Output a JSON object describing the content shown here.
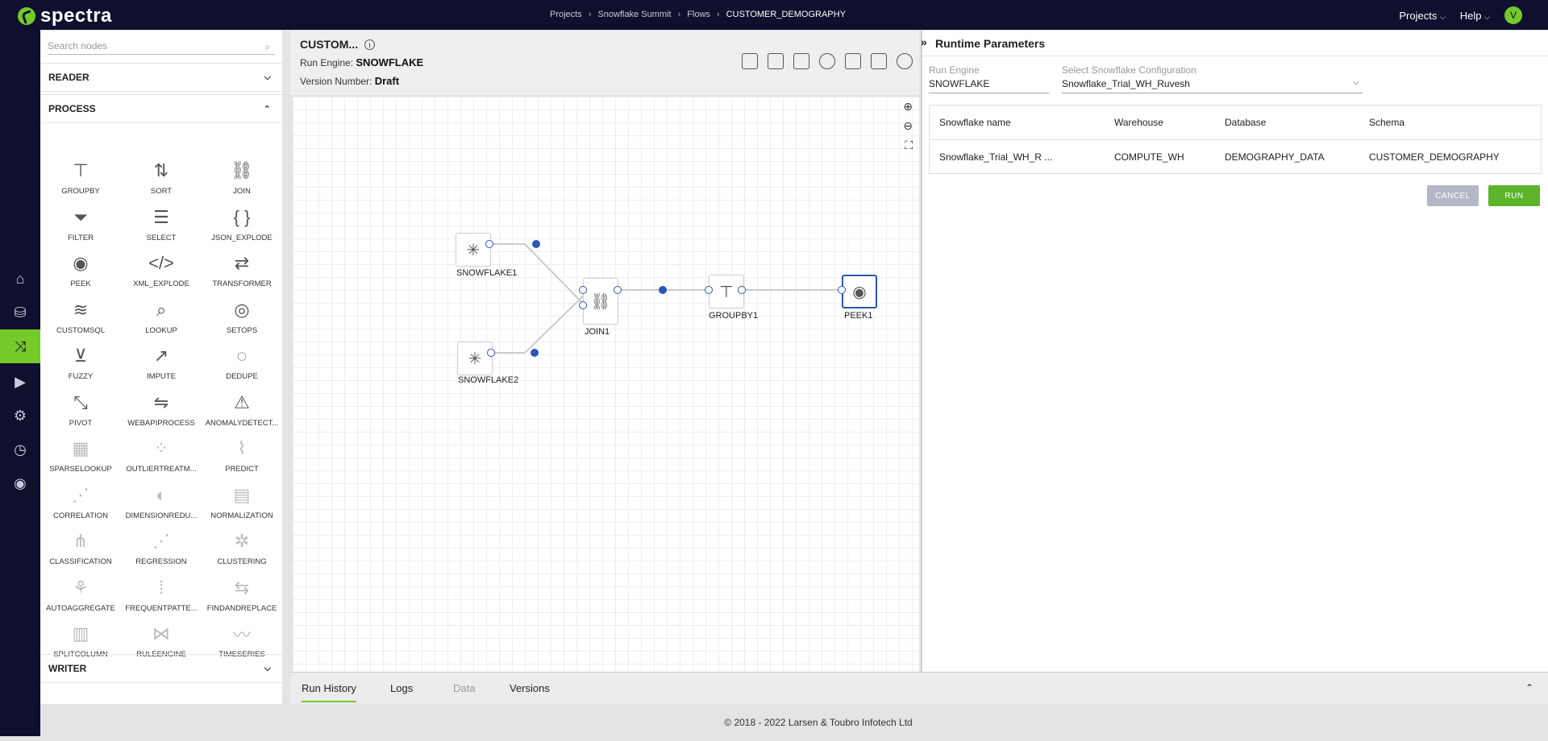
{
  "app": {
    "name": "spectra"
  },
  "breadcrumbs": [
    "Projects",
    "Snowflake Summit",
    "Flows",
    "CUSTOMER_DEMOGRAPHY"
  ],
  "topnav": {
    "projects": "Projects",
    "help": "Help",
    "avatar": "V"
  },
  "palette": {
    "search_placeholder": "Search nodes",
    "sections": {
      "reader": "READER",
      "process": "PROCESS",
      "writer": "WRITER"
    },
    "nodes": [
      {
        "label": "GROUPBY",
        "icon": "hierarchy-icon"
      },
      {
        "label": "SORT",
        "icon": "sort-icon"
      },
      {
        "label": "JOIN",
        "icon": "link-icon"
      },
      {
        "label": "FILTER",
        "icon": "funnel-icon"
      },
      {
        "label": "SELECT",
        "icon": "select-icon"
      },
      {
        "label": "JSON_EXPLODE",
        "icon": "json-icon"
      },
      {
        "label": "PEEK",
        "icon": "eye-icon"
      },
      {
        "label": "XML_EXPLODE",
        "icon": "xml-icon"
      },
      {
        "label": "TRANSFORMER",
        "icon": "transform-icon"
      },
      {
        "label": "CUSTOMSQL",
        "icon": "layers-icon"
      },
      {
        "label": "LOOKUP",
        "icon": "lookup-icon"
      },
      {
        "label": "SETOPS",
        "icon": "venn-icon"
      },
      {
        "label": "FUZZY",
        "icon": "fuzzy-icon"
      },
      {
        "label": "IMPUTE",
        "icon": "impute-icon"
      },
      {
        "label": "DEDUPE",
        "icon": "dedupe-icon"
      },
      {
        "label": "PIVOT",
        "icon": "pivot-icon"
      },
      {
        "label": "WEBAPIPROCESS",
        "icon": "api-icon"
      },
      {
        "label": "ANOMALYDETECT...",
        "icon": "warning-icon"
      },
      {
        "label": "SPARSELOOKUP",
        "icon": "sparse-icon"
      },
      {
        "label": "OUTLIERTREATM...",
        "icon": "scatter-icon"
      },
      {
        "label": "PREDICT",
        "icon": "predict-icon"
      },
      {
        "label": "CORRELATION",
        "icon": "correlation-icon"
      },
      {
        "label": "DIMENSIONREDU...",
        "icon": "dimension-icon"
      },
      {
        "label": "NORMALIZATION",
        "icon": "normalize-icon"
      },
      {
        "label": "CLASSIFICATION",
        "icon": "tree-icon"
      },
      {
        "label": "REGRESSION",
        "icon": "regression-icon"
      },
      {
        "label": "CLUSTERING",
        "icon": "cluster-icon"
      },
      {
        "label": "AUTOAGGREGATE",
        "icon": "aggregate-icon"
      },
      {
        "label": "FREQUENTPATTE...",
        "icon": "pattern-icon"
      },
      {
        "label": "FINDANDREPLACE",
        "icon": "replace-icon"
      },
      {
        "label": "SPLITCOLUMN",
        "icon": "split-icon"
      },
      {
        "label": "RULEENGINE",
        "icon": "rule-icon"
      },
      {
        "label": "TIMESERIES",
        "icon": "timeseries-icon"
      }
    ]
  },
  "flow": {
    "title": "CUSTOM...",
    "run_engine_label": "Run Engine:",
    "run_engine_value": "SNOWFLAKE",
    "version_label": "Version Number:",
    "version_value": "Draft",
    "nodes": {
      "snowflake1": "SNOWFLAKE1",
      "snowflake2": "SNOWFLAKE2",
      "join1": "JOIN1",
      "groupby1": "GROUPBY1",
      "peek1": "PEEK1"
    }
  },
  "runtime": {
    "title": "Runtime Parameters",
    "run_engine_label": "Run Engine",
    "run_engine_value": "SNOWFLAKE",
    "config_label": "Select Snowflake Configuration",
    "config_value": "Snowflake_Trial_WH_Ruvesh",
    "table": {
      "headers": [
        "Snowflake name",
        "Warehouse",
        "Database",
        "Schema"
      ],
      "row": [
        "Snowflake_Trial_WH_R ...",
        "COMPUTE_WH",
        "DEMOGRAPHY_DATA",
        "CUSTOMER_DEMOGRAPHY"
      ]
    },
    "cancel": "CANCEL",
    "run": "RUN"
  },
  "bottom_tabs": [
    "Run History",
    "Logs",
    "Data",
    "Versions"
  ],
  "footer": "© 2018 - 2022 Larsen & Toubro Infotech Ltd"
}
